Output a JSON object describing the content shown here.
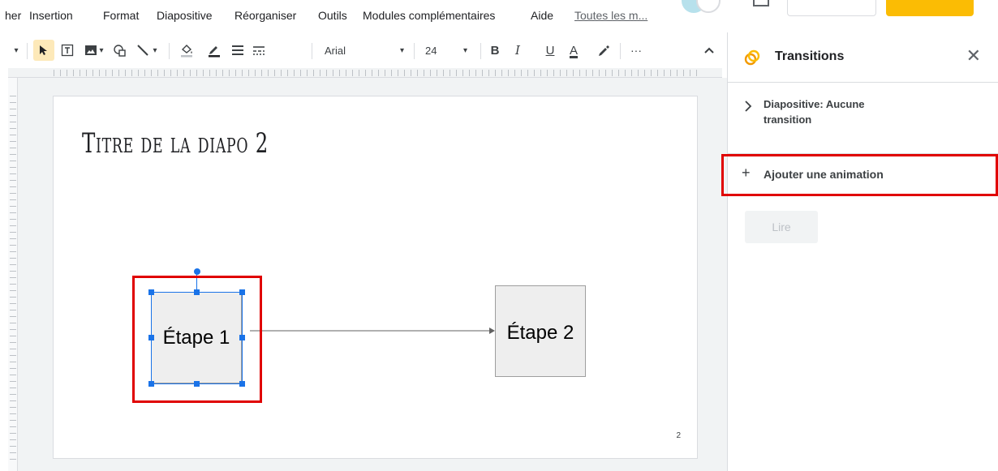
{
  "menubar": {
    "items": [
      "her",
      "Insertion",
      "Format",
      "Diapositive",
      "Réorganiser",
      "Outils",
      "Modules complémentaires",
      "Aide"
    ],
    "last_edit_link": "Toutes les m..."
  },
  "toolbar": {
    "font_name": "Arial",
    "font_size": "24",
    "bold": "B",
    "italic": "I",
    "underline": "U",
    "text_color": "A",
    "more": "···"
  },
  "slide": {
    "title": "Titre de la diapo 2",
    "box1_text": "Étape 1",
    "box2_text": "Étape 2",
    "page_number": "2"
  },
  "side_panel": {
    "title": "Transitions",
    "transition_label": "Diapositive: Aucune transition",
    "add_animation": "Ajouter une animation",
    "play_label": "Lire"
  },
  "colors": {
    "highlight_red": "#e00000",
    "selection_blue": "#1a73e8",
    "panel_icon_orange": "#f29900"
  }
}
